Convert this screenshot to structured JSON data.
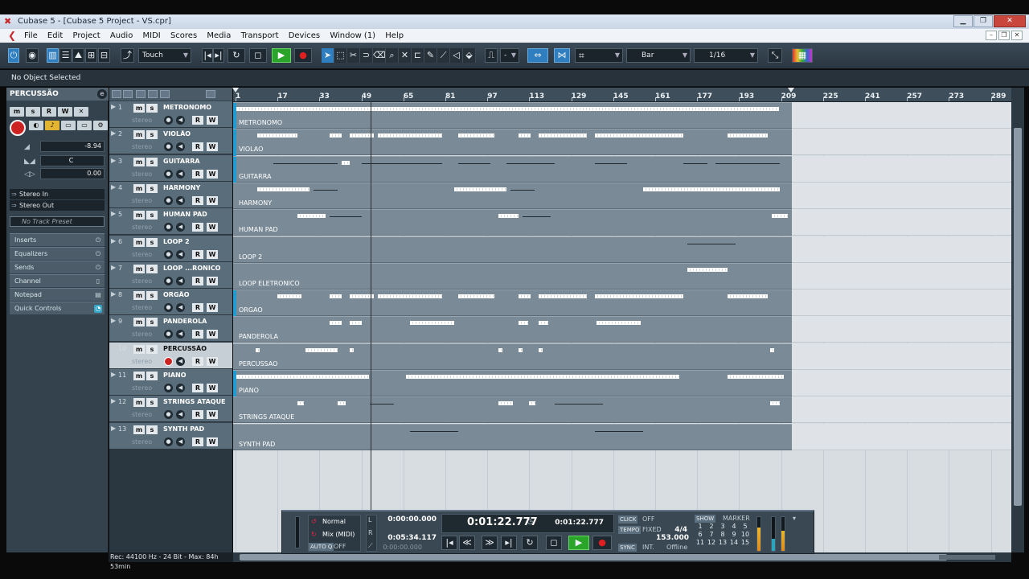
{
  "window": {
    "title": "Cubase 5 - [Cubase 5 Project - VS.cpr]"
  },
  "menu": [
    "File",
    "Edit",
    "Project",
    "Audio",
    "MIDI",
    "Scores",
    "Media",
    "Transport",
    "Devices",
    "Window (1)",
    "Help"
  ],
  "toolbar": {
    "automation_mode": "Touch",
    "nudge_value": "-",
    "grid_type": "Bar",
    "quantize": "1/16"
  },
  "infoline": {
    "text": "No Object Selected"
  },
  "inspector": {
    "track_name": "PERCUSSÃO",
    "volume": "-8.94",
    "pan": "C",
    "delay": "0.00",
    "input": "Stereo In",
    "output": "Stereo Out",
    "preset_placeholder": "No Track Preset",
    "sections": [
      "Inserts",
      "Equalizers",
      "Sends",
      "Channel",
      "Notepad",
      "Quick Controls"
    ],
    "status": "Rec: 44100 Hz - 24 Bit - Max: 84h 53min"
  },
  "tracks": [
    {
      "num": "1",
      "name": "METRONOMO",
      "stereo": "stereo",
      "part_label": "METRONOMO"
    },
    {
      "num": "2",
      "name": "VIOLÃO",
      "stereo": "stereo",
      "part_label": "VIOLAO"
    },
    {
      "num": "3",
      "name": "GUITARRA",
      "stereo": "stereo",
      "part_label": "GUITARRA"
    },
    {
      "num": "4",
      "name": "HARMONY",
      "stereo": "stereo",
      "part_label": "HARMONY"
    },
    {
      "num": "5",
      "name": "HUMAN PAD",
      "stereo": "stereo",
      "part_label": "HUMAN PAD"
    },
    {
      "num": "6",
      "name": "LOOP 2",
      "stereo": "stereo",
      "part_label": "LOOP 2"
    },
    {
      "num": "7",
      "name": "LOOP ...RONICO",
      "stereo": "stereo",
      "part_label": "LOOP ELETRONICO"
    },
    {
      "num": "8",
      "name": "ORGÃO",
      "stereo": "stereo",
      "part_label": "ORGAO"
    },
    {
      "num": "9",
      "name": "PANDEROLA",
      "stereo": "stereo",
      "part_label": "PANDEROLA"
    },
    {
      "num": "10",
      "name": "PERCUSSÃO",
      "stereo": "stereo",
      "part_label": "PERCUSSAO"
    },
    {
      "num": "11",
      "name": "PIANO",
      "stereo": "stereo",
      "part_label": "PIANO"
    },
    {
      "num": "12",
      "name": "STRINGS ATAQUE",
      "stereo": "stereo",
      "part_label": "STRINGS ATAQUE"
    },
    {
      "num": "13",
      "name": "SYNTH PAD",
      "stereo": "stereo",
      "part_label": "SYNTH PAD"
    }
  ],
  "button_labels": {
    "mute": "m",
    "solo": "s",
    "read": "R",
    "write": "W"
  },
  "ruler": [
    "1",
    "17",
    "33",
    "49",
    "65",
    "81",
    "97",
    "113",
    "129",
    "145",
    "161",
    "177",
    "193",
    "209",
    "225",
    "241",
    "257",
    "273",
    "289"
  ],
  "transport": {
    "mode": "Normal",
    "mix": "Mix (MIDI)",
    "auto_q": "AUTO Q",
    "auto_q_state": "OFF",
    "left_locator": "0:00:00.000",
    "right_locator": "0:05:34.117",
    "pre_roll": "0:00:00.000",
    "position": "0:01:22.777",
    "secondary_position": "0:01:22.777",
    "click_label": "CLICK",
    "click_state": "OFF",
    "tempo_label": "TEMPO",
    "tempo_mode": "FIXED",
    "signature": "4/4",
    "tempo": "153.000",
    "sync_label": "SYNC",
    "sync_mode": "INT.",
    "sync_state": "Offline",
    "show_label": "SHOW",
    "marker_label": "MARKER",
    "markers": [
      "1",
      "2",
      "3",
      "4",
      "5",
      "6",
      "7",
      "8",
      "9",
      "10",
      "11",
      "12",
      "13",
      "14",
      "15"
    ]
  }
}
